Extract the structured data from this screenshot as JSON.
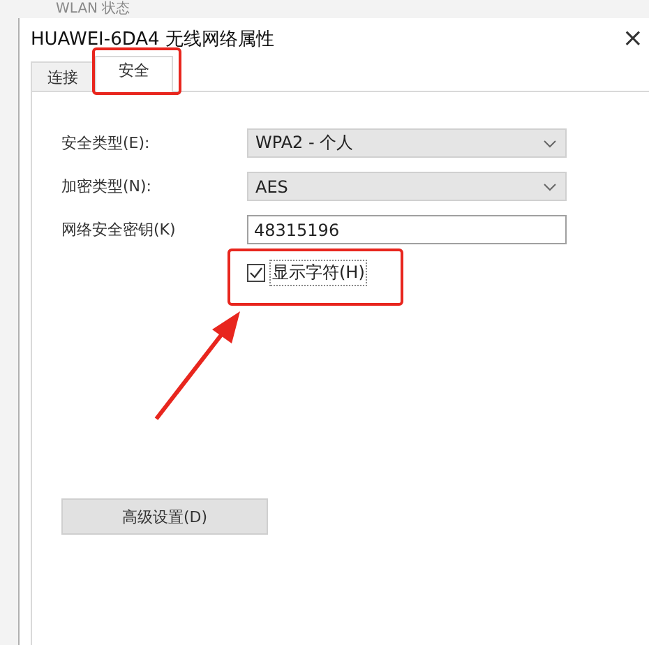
{
  "background_window": {
    "title": "WLAN 状态"
  },
  "window": {
    "title": "HUAWEI-6DA4 无线网络属性",
    "close": "×"
  },
  "tabs": [
    {
      "label": "连接",
      "selected": false
    },
    {
      "label": "安全",
      "selected": true
    }
  ],
  "fields": [
    {
      "kind": "dropdown",
      "label": "安全类型(E):",
      "value": "WPA2 - 个人"
    },
    {
      "kind": "dropdown",
      "label": "加密类型(N):",
      "value": "AES"
    },
    {
      "kind": "text",
      "label": "网络安全密钥(K)",
      "value": "48315196"
    }
  ],
  "show_characters": {
    "label": "显示字符(H)",
    "checked": true
  },
  "buttons": [
    {
      "label": "高级设置(D)"
    }
  ]
}
